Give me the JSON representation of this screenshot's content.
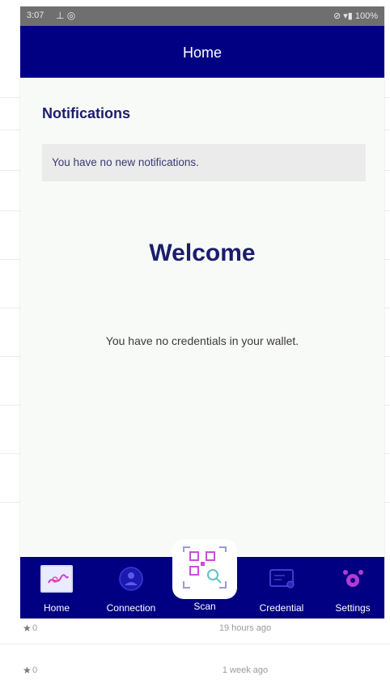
{
  "status_bar": {
    "time": "3:07",
    "left_icons": "⊥ ◎",
    "right_text": "⊘ ▾▮ 100%"
  },
  "header": {
    "title": "Home"
  },
  "notifications": {
    "title": "Notifications",
    "empty_message": "You have no new notifications."
  },
  "welcome": {
    "title": "Welcome",
    "message": "You have no credentials in your wallet."
  },
  "tabs": [
    {
      "label": "Home",
      "icon": "home-icon"
    },
    {
      "label": "Connection",
      "icon": "connection-icon"
    },
    {
      "label": "Scan",
      "icon": "qr-scan-icon"
    },
    {
      "label": "Credential",
      "icon": "credential-icon"
    },
    {
      "label": "Settings",
      "icon": "settings-icon"
    }
  ],
  "background_list": [
    {
      "count": "0",
      "time": "19 hours ago"
    },
    {
      "count": "0",
      "time": "1 week ago"
    }
  ],
  "colors": {
    "primary": "#020082",
    "heading": "#1b1d6c",
    "icon_accent": "#b23bd6",
    "status_bar": "#6f6f6f"
  }
}
